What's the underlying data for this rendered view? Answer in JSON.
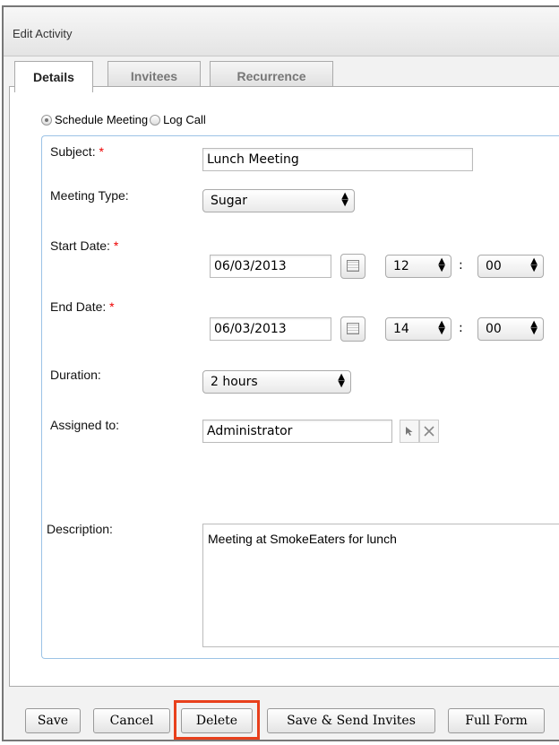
{
  "dialog": {
    "title": "Edit Activity"
  },
  "tabs": [
    {
      "label": "Details",
      "active": true
    },
    {
      "label": "Invitees",
      "active": false
    },
    {
      "label": "Recurrence",
      "active": false
    }
  ],
  "activity_type": {
    "options": [
      "Schedule Meeting",
      "Log Call"
    ],
    "selected": "Schedule Meeting"
  },
  "form": {
    "subject": {
      "label": "Subject:",
      "required": "*",
      "value": "Lunch Meeting"
    },
    "meeting_type": {
      "label": "Meeting Type:",
      "value": "Sugar"
    },
    "start_date": {
      "label": "Start Date:",
      "required": "*",
      "date": "06/03/2013",
      "hour": "12",
      "minute": "00",
      "separator": ":"
    },
    "end_date": {
      "label": "End Date:",
      "required": "*",
      "date": "06/03/2013",
      "hour": "14",
      "minute": "00",
      "separator": ":"
    },
    "duration": {
      "label": "Duration:",
      "value": "2 hours"
    },
    "assigned_to": {
      "label": "Assigned to:",
      "value": "Administrator"
    },
    "description": {
      "label": "Description:",
      "value": "Meeting at SmokeEaters for lunch"
    }
  },
  "buttons": {
    "save": "Save",
    "cancel": "Cancel",
    "delete": "Delete",
    "save_send": "Save & Send Invites",
    "full_form": "Full Form"
  },
  "colors": {
    "highlight": "#e8401c",
    "required": "#e00000",
    "form_border": "#9cc3e6"
  }
}
